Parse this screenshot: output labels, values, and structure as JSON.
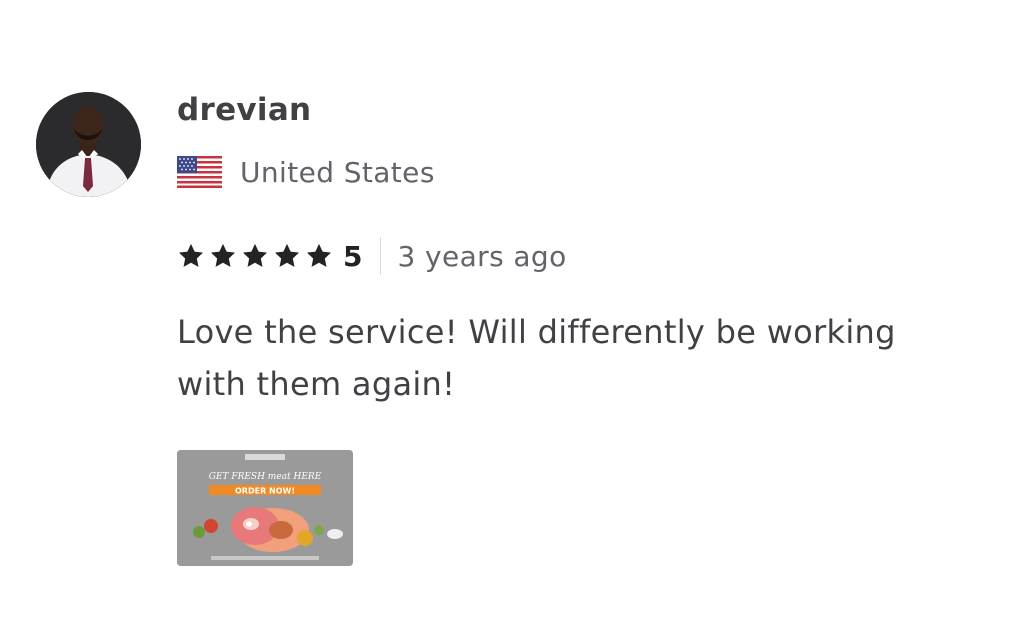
{
  "review": {
    "username": "drevian",
    "country": "United States",
    "country_flag_icon": "us-flag-icon",
    "rating": {
      "stars": 5,
      "max_stars": 5,
      "value_label": "5"
    },
    "time_ago": "3 years ago",
    "text": "Love the service! Will differently be working with them again!",
    "attachment": {
      "headline": "GET FRESH meat HERE",
      "cta": "ORDER NOW!"
    }
  },
  "colors": {
    "star": "#222325",
    "text": "#404145",
    "muted": "#62646a",
    "divider": "#dadbdd",
    "attachment_bg": "#9b9b9b",
    "attachment_banner": "#f08a24"
  }
}
